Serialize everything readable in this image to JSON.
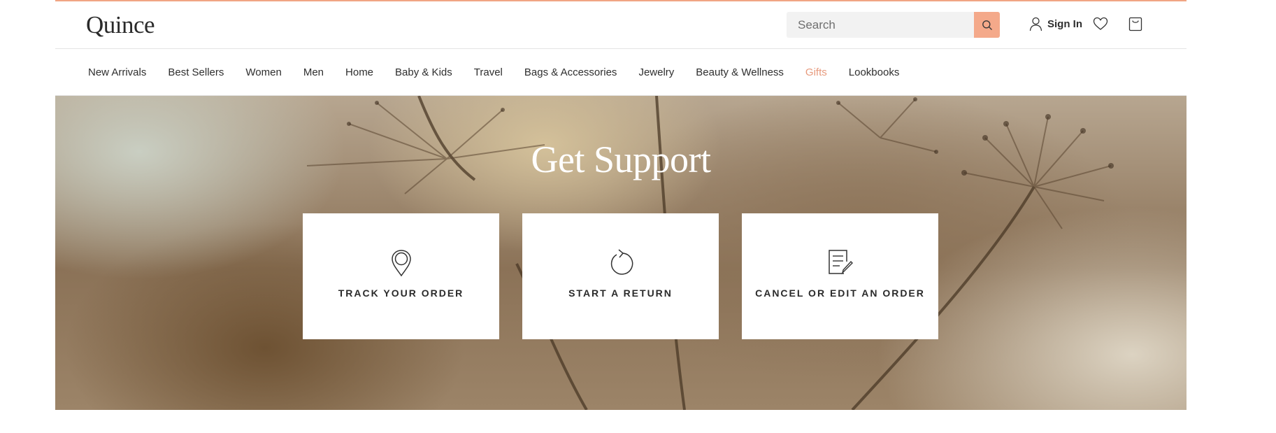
{
  "header": {
    "logo": "Quince",
    "search": {
      "placeholder": "Search",
      "button_icon": "search-icon"
    },
    "sign_in_label": "Sign In",
    "icons": [
      "user-icon",
      "heart-icon",
      "bag-icon"
    ],
    "accent_color": "#f4a98a"
  },
  "nav": {
    "items": [
      {
        "label": "New Arrivals"
      },
      {
        "label": "Best Sellers"
      },
      {
        "label": "Women"
      },
      {
        "label": "Men"
      },
      {
        "label": "Home"
      },
      {
        "label": "Baby & Kids"
      },
      {
        "label": "Travel"
      },
      {
        "label": "Bags & Accessories"
      },
      {
        "label": "Jewelry"
      },
      {
        "label": "Beauty & Wellness"
      },
      {
        "label": "Gifts",
        "highlight": true,
        "color": "#e79a7d"
      },
      {
        "label": "Lookbooks"
      }
    ]
  },
  "hero": {
    "title": "Get Support",
    "cards": [
      {
        "label": "TRACK YOUR ORDER",
        "icon": "map-pin-icon"
      },
      {
        "label": "START A RETURN",
        "icon": "return-arrow-icon"
      },
      {
        "label": "CANCEL OR EDIT AN ORDER",
        "icon": "edit-document-icon"
      }
    ]
  }
}
